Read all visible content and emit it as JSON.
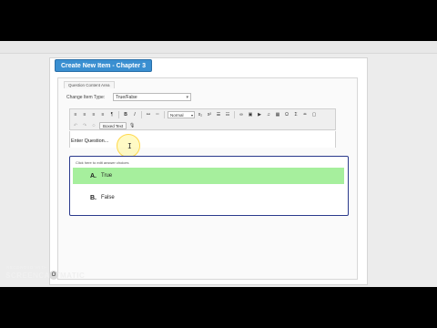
{
  "window": {
    "title": "Create New Item - Chapter 3"
  },
  "panel": {
    "tab_label": "Question Content Area"
  },
  "item_type": {
    "label": "Change Item Type:",
    "value": "True/False"
  },
  "toolbar": {
    "format_value": "Normal",
    "text_button": "Boxed Text",
    "row1_icons": [
      "align-left-icon",
      "align-center-icon",
      "align-right-icon",
      "align-justify-icon",
      "superscript-sign-icon",
      "bold-icon",
      "italic-icon",
      "link-icon",
      "unlink-icon"
    ],
    "row2_icons": [
      "undo-icon",
      "redo-icon",
      "format-icon",
      "microphone-icon"
    ]
  },
  "editor": {
    "placeholder": "Enter Question..."
  },
  "answers": {
    "hint": "Click here to edit answer choices",
    "items": [
      {
        "letter": "A.",
        "label": "True",
        "selected": true
      },
      {
        "letter": "B.",
        "label": "False",
        "selected": false
      }
    ]
  },
  "watermark": {
    "small": "RECORDED WITH",
    "big": "SCREENCAST",
    "circle": "O",
    "tail": "MATIC"
  },
  "colors": {
    "title_tab": "#3a8fd1",
    "selected_answer": "#a6ef9d",
    "answers_border": "#2b3a8c"
  }
}
